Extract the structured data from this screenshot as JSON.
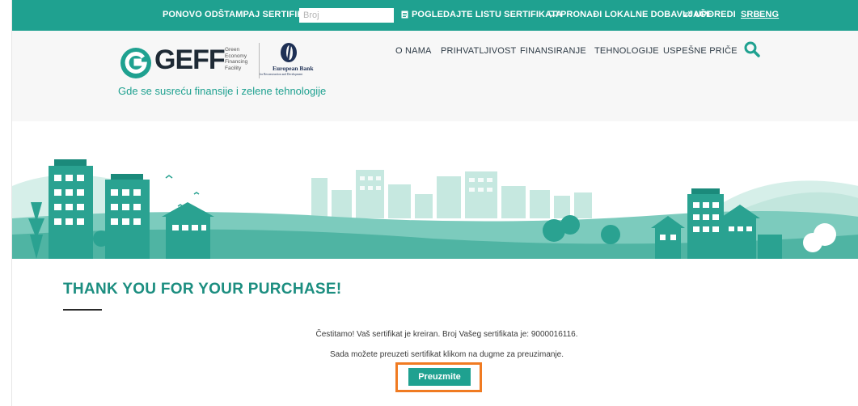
{
  "topbar": {
    "reprint_label": "PONOVO ODŠTAMPAJ SERTIFIKAT:",
    "reprint_placeholder": "Broj",
    "view_list_label": "POGLEDAJTE LISTU SERTIFIKATA",
    "find_suppliers_label": "PRONAĐI LOKALNE DOBAVLJAČE",
    "compare_label": "UPOREDI",
    "lang_srb": "SRB",
    "lang_eng": "ENG",
    "bar_color": "#1fa190"
  },
  "header": {
    "logo_word": "GEFF",
    "logo_small_lines": [
      "Green",
      "Economy",
      "Financing",
      "Facility"
    ],
    "ebrd_name_1": "European Bank",
    "ebrd_sub": "for Reconstruction and Development",
    "tagline": "Gde se susreću finansije i zelene tehnologije",
    "nav": [
      "O NAMA",
      "PRIHVATLJIVOST",
      "FINANSIRANJE",
      "TEHNOLOGIJE",
      "USPEŠNE PRIČE"
    ],
    "search_icon": "search-icon"
  },
  "content": {
    "heading": "THANK YOU FOR YOUR PURCHASE!",
    "message_1": "Čestitamo! Vaš sertifikat je kreiran. Broj Vašeg sertifikata je: 9000016116.",
    "message_2": "Sada možete preuzeti sertifikat klikom na dugme za preuzimanje.",
    "download_button": "Preuzmite",
    "accent_color": "#1fa190",
    "highlight_color": "#f07b22"
  }
}
